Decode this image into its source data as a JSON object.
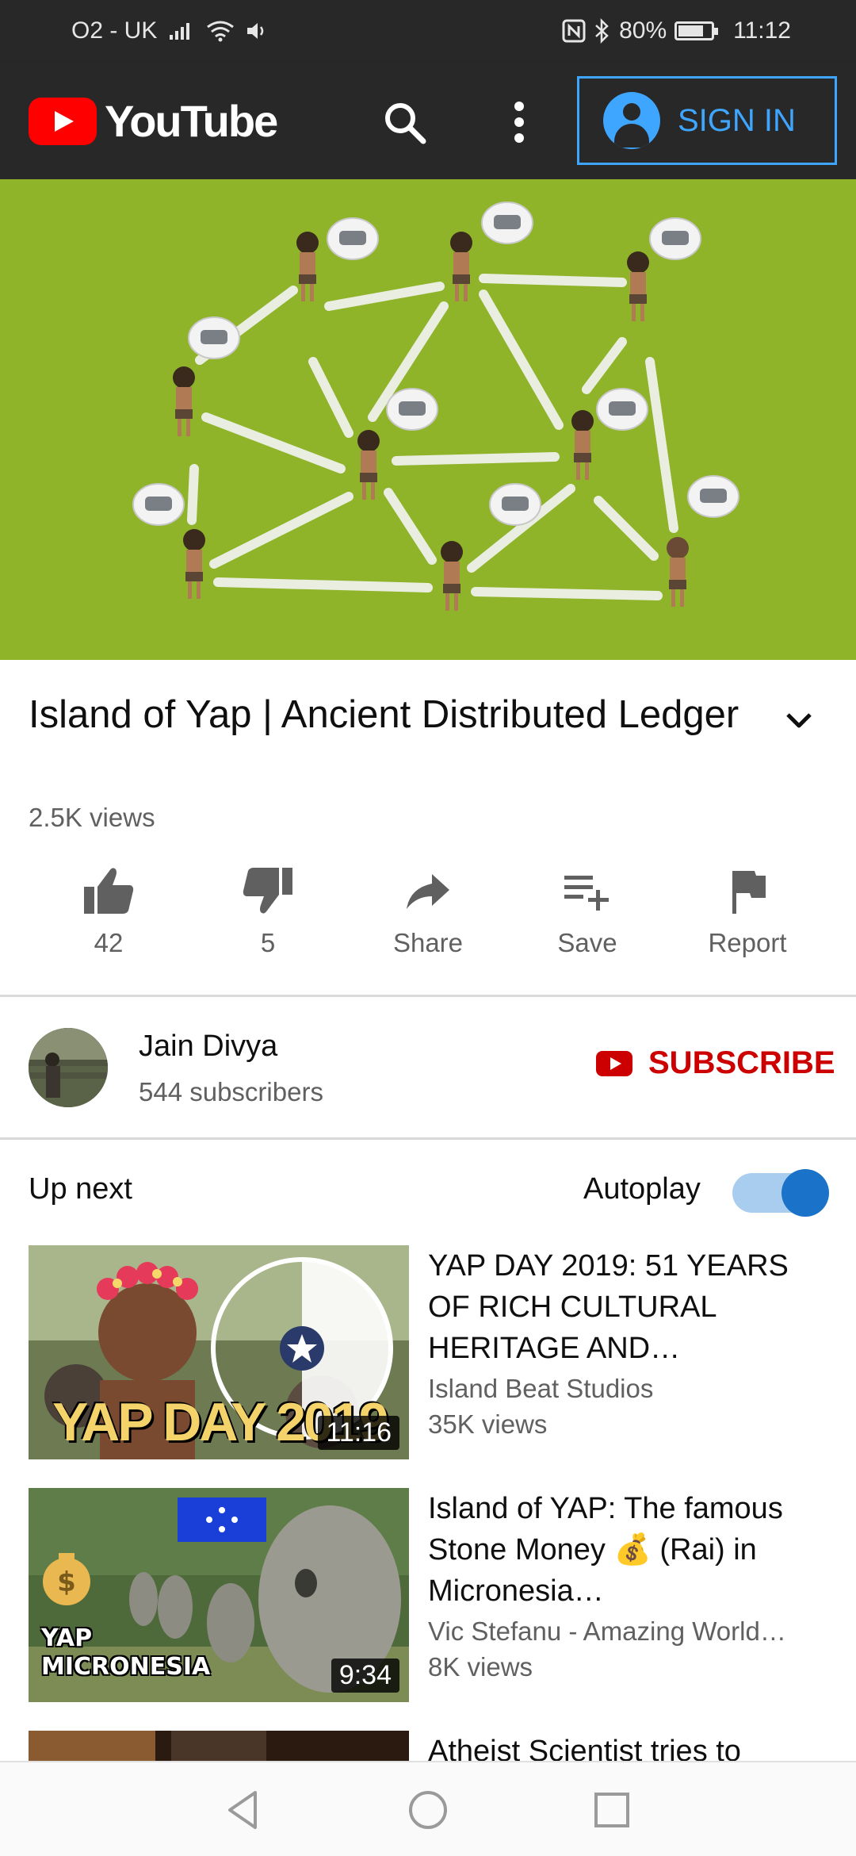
{
  "status_bar": {
    "carrier": "O2 - UK",
    "battery": "80%",
    "time": "11:12",
    "icons": [
      "signal-icon",
      "wifi-icon",
      "volume-icon",
      "nfc-icon",
      "bluetooth-icon",
      "battery-icon"
    ],
    "battery_level": 0.8
  },
  "app_bar": {
    "logo_text": "YouTube",
    "sign_in_label": "SIGN IN",
    "icons": [
      "youtube-logo-icon",
      "search-icon",
      "more-vert-icon",
      "account-circle-icon"
    ]
  },
  "video": {
    "title": "Island of Yap | Ancient Distributed Ledger",
    "views": "2.5K views"
  },
  "actions": {
    "like_count": "42",
    "dislike_count": "5",
    "share_label": "Share",
    "save_label": "Save",
    "report_label": "Report"
  },
  "channel": {
    "name": "Jain Divya",
    "subscribers": "544 subscribers",
    "subscribe_label": "SUBSCRIBE"
  },
  "up_next": {
    "heading": "Up next",
    "autoplay_label": "Autoplay",
    "autoplay_on": true
  },
  "up_next_items": [
    {
      "title": "YAP DAY 2019: 51 YEARS OF RICH CULTURAL HERITAGE AND…",
      "channel": "Island Beat Studios",
      "views": "35K views",
      "duration": "11:16",
      "thumb_text": "YAP DAY 2019"
    },
    {
      "title": "Island of YAP: The famous Stone Money 💰 (Rai) in Micronesia…",
      "channel": "Vic Stefanu - Amazing World…",
      "views": "8K views",
      "duration": "9:34",
      "thumb_text": "YAP MICRONESIA"
    },
    {
      "title": "Atheist Scientist tries to"
    }
  ],
  "colors": {
    "youtube_red": "#ff0000",
    "subscribe_red": "#cc0000",
    "sign_in_blue": "#3ea6ff",
    "video_green": "#8fb42a",
    "app_bar": "#282828"
  }
}
